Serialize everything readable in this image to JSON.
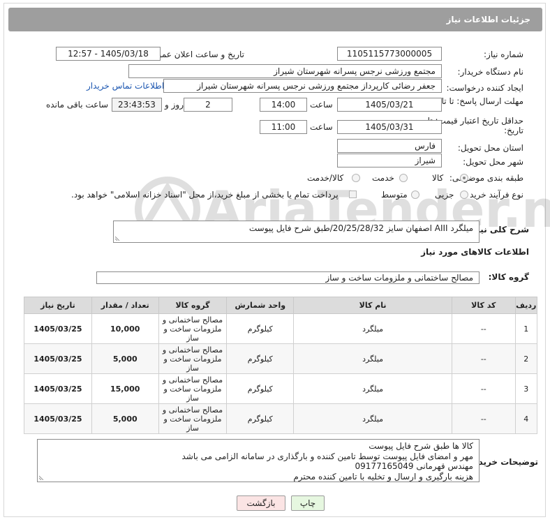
{
  "header": {
    "title": "جزئیات اطلاعات نیاز"
  },
  "fields": {
    "need_number_label": "شماره نیاز:",
    "need_number": "1105115773000005",
    "announce_label": "تاریخ و ساعت اعلان عمومی:",
    "announce_value": "1405/03/18 - 12:57",
    "buyer_org_label": "نام دستگاه خریدار:",
    "buyer_org": "مجتمع ورزشی نرجس پسرانه شهرستان شیراز",
    "requester_label": "ایجاد کننده درخواست:",
    "requester": "جعفر رضائی کارپرداز مجتمع ورزشی نرجس پسرانه شهرستان شیراز",
    "contact_link": "اطلاعات تماس خریدار",
    "deadline_label": "مهلت ارسال پاسخ: تا تاریخ:",
    "deadline_date": "1405/03/21",
    "time_label": "ساعت",
    "deadline_time": "14:00",
    "days_value": "2",
    "days_label": "روز و",
    "remaining_time": "23:43:53",
    "remaining_label": "ساعت باقی مانده",
    "price_validity_label": "حداقل تاریخ اعتبار قیمت: تا تاریخ:",
    "price_date": "1405/03/31",
    "price_time": "11:00",
    "province_label": "استان محل تحویل:",
    "province": "فارس",
    "city_label": "شهر محل تحویل:",
    "city": "شیراز",
    "category_label": "طبقه بندی موضوعی:",
    "category_options": [
      "کالا",
      "خدمت",
      "کالا/خدمت"
    ],
    "process_label": "نوع فرآیند خرید :",
    "process_options": [
      "جزیی",
      "متوسط"
    ],
    "payment_note": "پرداخت تمام یا بخشی از مبلغ خرید،از محل \"اسناد خزانه اسلامی\" خواهد بود."
  },
  "description": {
    "label": "شرح کلی نیاز:",
    "value": "میلگرد AIII اصفهان سایز 20/25/28/32/طبق شرح فایل پیوست"
  },
  "goods_info": {
    "title": "اطلاعات کالاهای مورد نیاز",
    "group_label": "گروه کالا:",
    "group_value": "مصالح ساختمانی و ملزومات ساخت و ساز"
  },
  "table": {
    "headers": [
      "ردیف",
      "کد کالا",
      "نام کالا",
      "واحد شمارش",
      "گروه کالا",
      "تعداد / مقدار",
      "تاریخ نیاز"
    ],
    "rows": [
      [
        "1",
        "--",
        "میلگرد",
        "کیلوگرم",
        "مصالح ساختمانی و ملزومات ساخت و ساز",
        "10,000",
        "1405/03/25"
      ],
      [
        "2",
        "--",
        "میلگرد",
        "کیلوگرم",
        "مصالح ساختمانی و ملزومات ساخت و ساز",
        "5,000",
        "1405/03/25"
      ],
      [
        "3",
        "--",
        "میلگرد",
        "کیلوگرم",
        "مصالح ساختمانی و ملزومات ساخت و ساز",
        "15,000",
        "1405/03/25"
      ],
      [
        "4",
        "--",
        "میلگرد",
        "کیلوگرم",
        "مصالح ساختمانی و ملزومات ساخت و ساز",
        "5,000",
        "1405/03/25"
      ]
    ]
  },
  "buyer_notes": {
    "label": "توضیحات خریدار:",
    "lines": [
      "کالا ها طبق شرح فایل پیوست",
      "مهر و امضای فایل پیوست توسط تامین کننده و بارگذاری در سامانه الزامی می باشد",
      "مهندس قهرمانی 09177165049",
      "هزینه بارگیری و ارسال و تخلیه با تامین کننده محترم"
    ]
  },
  "buttons": {
    "print": "چاپ",
    "back": "بازگشت"
  },
  "watermark": {
    "text": "AriaTender.neT"
  }
}
